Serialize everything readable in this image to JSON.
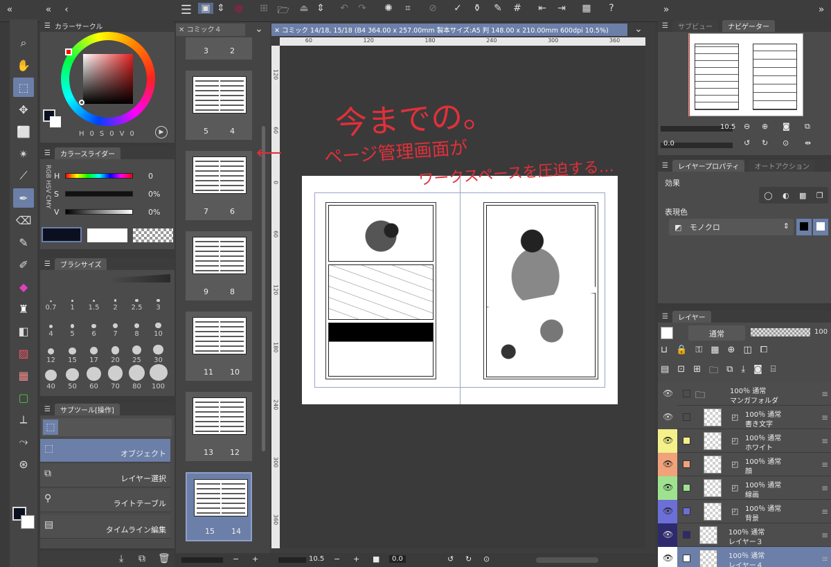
{
  "top_toolbar": {
    "icons": [
      "menu-icon",
      "new-file-icon",
      "open-icon",
      "save-icon",
      "undo-icon",
      "redo-icon",
      "loading-icon",
      "transform-icon",
      "hide-selection-icon",
      "check-icon",
      "bucket-icon",
      "pen-icon",
      "grid-icon",
      "import-icon",
      "export-icon",
      "layout-icon",
      "help-icon"
    ]
  },
  "tools": [
    "search-icon",
    "hand-icon",
    "operation-icon",
    "move-icon",
    "select-rect-icon",
    "magic-wand-icon",
    "eyedropper-icon",
    "pen-tool-icon",
    "eraser-icon",
    "brush-icon",
    "marker-icon",
    "fill-icon",
    "decoration-icon",
    "gradient-icon",
    "figure-icon",
    "text-icon",
    "frame-icon",
    "ruler-icon",
    "correction-icon",
    "3d-icon"
  ],
  "color_circle": {
    "title": "カラーサークル",
    "hsv": {
      "h": "H",
      "h_val": "0",
      "s": "S",
      "s_val": "0",
      "v": "V",
      "v_val": "0"
    }
  },
  "color_slider": {
    "title": "カラースライダー",
    "modes": [
      "RGB",
      "HSV",
      "CMY"
    ],
    "rows": [
      {
        "label": "H",
        "value": "0"
      },
      {
        "label": "S",
        "value": "0%"
      },
      {
        "label": "V",
        "value": "0%"
      }
    ]
  },
  "brush_size": {
    "title": "ブラシサイズ",
    "sizes": [
      "0.7",
      "1",
      "1.5",
      "2",
      "2.5",
      "3",
      "4",
      "5",
      "6",
      "7",
      "8",
      "10",
      "12",
      "15",
      "17",
      "20",
      "25",
      "30",
      "40",
      "50",
      "60",
      "70",
      "80",
      "100"
    ]
  },
  "sub_tool": {
    "title": "サブツール[操作]",
    "items": [
      "オブジェクト",
      "レイヤー選択",
      "ライトテーブル",
      "タイムライン編集"
    ]
  },
  "page_manager": {
    "tab": "コミック４",
    "rows": [
      {
        "left": "3",
        "right": "2"
      },
      {
        "left": "5",
        "right": "4"
      },
      {
        "left": "7",
        "right": "6"
      },
      {
        "left": "9",
        "right": "8"
      },
      {
        "left": "11",
        "right": "10"
      },
      {
        "left": "13",
        "right": "12"
      },
      {
        "left": "15",
        "right": "14"
      }
    ]
  },
  "canvas": {
    "tab": "コミック 14/18, 15/18 (B4 364.00 x 257.00mm 製本サイズ:A5 判 148.00 x 210.00mm 600dpi 10.5%)",
    "ruler_top": [
      "60",
      "120",
      "180",
      "240",
      "300",
      "360"
    ],
    "ruler_left": [
      "120",
      "60",
      "0",
      "60",
      "120",
      "180",
      "240",
      "300",
      "360"
    ],
    "annotation_line1": "今までの。",
    "annotation_line2": "ページ管理画面が",
    "annotation_line3": "ワークスペースを圧迫する…",
    "zoom": "10.5",
    "angle": "0.0"
  },
  "navigator": {
    "tabs": [
      "サブビュー",
      "ナビゲーター"
    ],
    "zoom": "10.5",
    "angle": "0.0"
  },
  "layer_property": {
    "tabs": [
      "レイヤープロパティ",
      "オートアクション"
    ],
    "effect_label": "効果",
    "expression_label": "表現色",
    "expression_value": "モノクロ"
  },
  "layers": {
    "tab": "レイヤー",
    "blend": "通常",
    "opacity": "100",
    "items": [
      {
        "pct": "100％ 通常",
        "name": "マンガフォルダ",
        "color": "#4d4d4d"
      },
      {
        "pct": "100％ 通常",
        "name": "書き文字",
        "color": "#4d4d4d"
      },
      {
        "pct": "100％ 通常",
        "name": "ホワイト",
        "color": "#f4f08a"
      },
      {
        "pct": "100％ 通常",
        "name": "顔",
        "color": "#f0a37a"
      },
      {
        "pct": "100％ 通常",
        "name": "線画",
        "color": "#9ee28f"
      },
      {
        "pct": "100％ 通常",
        "name": "背景",
        "color": "#6c6fd6"
      },
      {
        "pct": "100％ 通常",
        "name": "レイヤー３",
        "color": "#2d2a6e"
      },
      {
        "pct": "100％ 通常",
        "name": "レイヤー４",
        "color": "#ffffff"
      }
    ]
  },
  "colors": {
    "annotation": "#e0303a",
    "selected": "#6b7fa8"
  }
}
